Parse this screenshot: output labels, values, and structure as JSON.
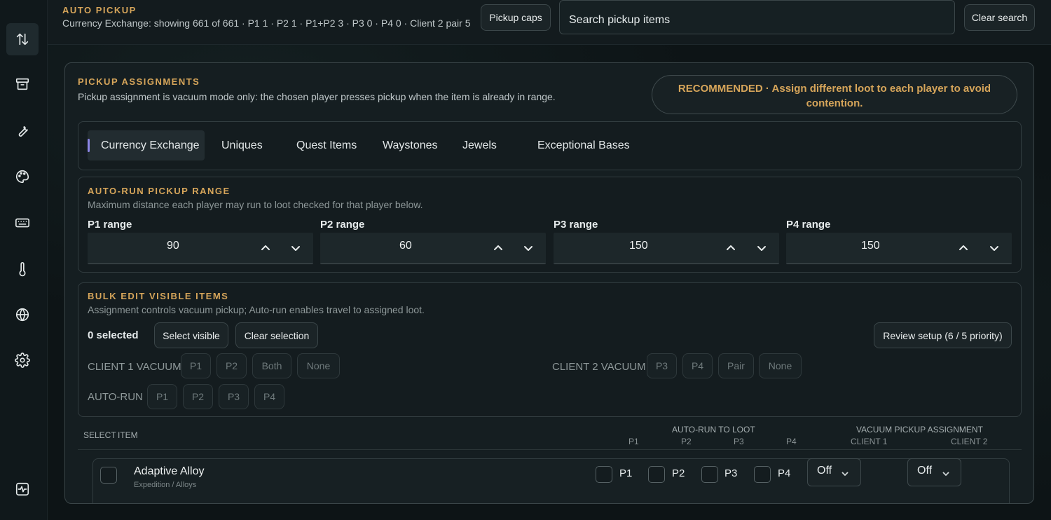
{
  "header": {
    "title": "AUTO PICKUP",
    "subtitle": "Currency Exchange: showing 661 of 661 · P1 1 · P2 1 · P1+P2 3 · P3 0 · P4 0 · Client 2 pair 5",
    "pickup_caps_label": "Pickup caps",
    "search_placeholder": "Search pickup items",
    "clear_search_label": "Clear search"
  },
  "sidebar": {
    "icons": [
      "sort-arrows-icon",
      "archive-icon",
      "wrench-icon",
      "palette-icon",
      "keyboard-icon",
      "thermometer-icon",
      "globe-icon",
      "gear-icon",
      "activity-icon"
    ],
    "active_index": 0
  },
  "assignments": {
    "title": "PICKUP ASSIGNMENTS",
    "subtitle": "Pickup assignment is vacuum mode only: the chosen player presses pickup when the item is already in range.",
    "recommendation": "RECOMMENDED · Assign different loot to each player to avoid contention."
  },
  "tabs": [
    {
      "label": "Currency Exchange",
      "active": true
    },
    {
      "label": "Uniques",
      "active": false
    },
    {
      "label": "Quest Items",
      "active": false
    },
    {
      "label": "Waystones",
      "active": false
    },
    {
      "label": "Jewels",
      "active": false
    },
    {
      "label": "Exceptional Bases",
      "active": false
    }
  ],
  "auto_run": {
    "title": "AUTO-RUN PICKUP RANGE",
    "subtitle": "Maximum distance each player may run to loot checked for that player below.",
    "ranges": [
      {
        "label": "P1 range",
        "value": "90"
      },
      {
        "label": "P2 range",
        "value": "60"
      },
      {
        "label": "P3 range",
        "value": "150"
      },
      {
        "label": "P4 range",
        "value": "150"
      }
    ]
  },
  "bulk_edit": {
    "title": "BULK EDIT VISIBLE ITEMS",
    "subtitle": "Assignment controls vacuum pickup; Auto-run enables travel to assigned loot.",
    "selected_count": "0 selected",
    "select_visible_label": "Select visible",
    "clear_selection_label": "Clear selection",
    "review_setup_label": "Review setup (6 / 5 priority)",
    "client1_label": "CLIENT 1 VACUUM",
    "client1_options": [
      "P1",
      "P2",
      "Both",
      "None"
    ],
    "client2_label": "CLIENT 2 VACUUM",
    "client2_options": [
      "P3",
      "P4",
      "Pair",
      "None"
    ],
    "autorun_label": "AUTO-RUN",
    "autorun_options": [
      "P1",
      "P2",
      "P3",
      "P4"
    ]
  },
  "table": {
    "col_select": "SELECT",
    "col_item": "ITEM",
    "group_autorun": "AUTO-RUN TO LOOT",
    "autorun_cols": [
      "P1",
      "P2",
      "P3",
      "P4"
    ],
    "group_vacuum": "VACUUM PICKUP ASSIGNMENT",
    "vacuum_cols": [
      "CLIENT 1",
      "CLIENT 2"
    ],
    "rows": [
      {
        "name": "Adaptive Alloy",
        "category": "Expedition / Alloys",
        "checked": false,
        "autorun": [
          {
            "label": "P1",
            "checked": false
          },
          {
            "label": "P2",
            "checked": false
          },
          {
            "label": "P3",
            "checked": false
          },
          {
            "label": "P4",
            "checked": false
          }
        ],
        "client1": "Off",
        "client2": "Off"
      }
    ]
  }
}
